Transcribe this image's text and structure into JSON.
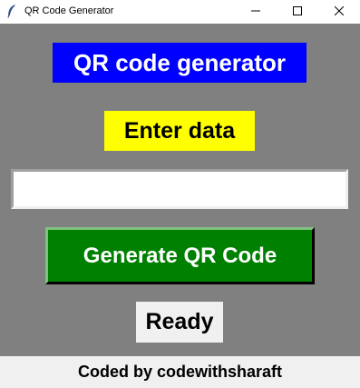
{
  "window": {
    "title": "QR Code Generator",
    "icon": "feather-icon",
    "controls": [
      "minimize-icon",
      "maximize-icon",
      "close-icon"
    ]
  },
  "heading": {
    "text": "QR code generator",
    "bg_color": "#0000ff",
    "text_color": "#ffffff"
  },
  "prompt": {
    "text": "Enter data",
    "bg_color": "#ffff00"
  },
  "entry": {
    "value": "",
    "placeholder": ""
  },
  "generate_button": {
    "label": "Generate QR Code",
    "bg_color": "#008000",
    "text_color": "#ffffff"
  },
  "status": {
    "text": "Ready"
  },
  "footer": {
    "text": "Coded by codewithsharaft"
  },
  "colors": {
    "window_bg": "#808080",
    "footer_bg": "#f0f0f0"
  }
}
